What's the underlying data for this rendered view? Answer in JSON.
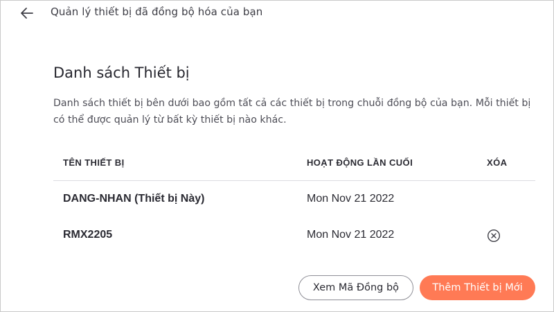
{
  "header": {
    "title": "Quản lý thiết bị đã đồng bộ hóa của bạn",
    "back_icon": "arrow-left-icon"
  },
  "main": {
    "heading": "Danh sách Thiết bị",
    "description": "Danh sách thiết bị bên dưới bao gồm tất cả các thiết bị trong chuỗi đồng bộ của bạn. Mỗi thiết bị có thể được quản lý từ bất kỳ thiết bị nào khác."
  },
  "table": {
    "columns": {
      "name": "TÊN THIẾT BỊ",
      "last_active": "HOẠT ĐỘNG LẦN CUỐI",
      "remove": "XÓA"
    },
    "rows": [
      {
        "name": "DANG-NHAN (Thiết bị Này)",
        "last_active": "Mon Nov 21 2022",
        "removable": false
      },
      {
        "name": "RMX2205",
        "last_active": "Mon Nov 21 2022",
        "removable": true,
        "remove_icon": "circle-x-icon"
      }
    ]
  },
  "actions": {
    "view_code_label": "Xem Mã Đồng bộ",
    "add_device_label": "Thêm Thiết bị Mới"
  },
  "colors": {
    "accent": "#ff7a55",
    "text": "#2a2a32",
    "muted_text": "#4d4d56",
    "divider": "#dcdce0"
  }
}
